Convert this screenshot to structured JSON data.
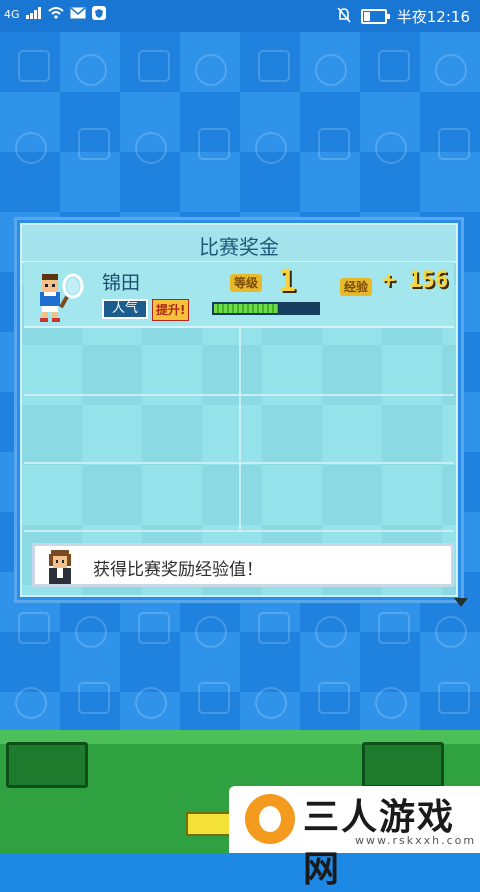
{
  "status_bar": {
    "network": "4G",
    "time": "半夜12:16",
    "battery_level": 0.35
  },
  "dialog": {
    "title": "比赛奖金",
    "player": {
      "name": "锦田",
      "popularity_label": "人气",
      "promoted_label": "提升!",
      "level_label": "等级",
      "level": "1",
      "exp_label": "经验",
      "exp_gain": "+ 156",
      "exp_bar_fill": 0.62
    },
    "empty_rows": 3,
    "message": "获得比赛奖励经验值！"
  },
  "watermark": {
    "text": "三人游戏网",
    "url": "www.rskxxh.com"
  },
  "colors": {
    "background_blue": "#1e88e5",
    "dialog_teal": "#8fdde6",
    "grass_green": "#2fa141",
    "gold": "#f7d43d"
  }
}
